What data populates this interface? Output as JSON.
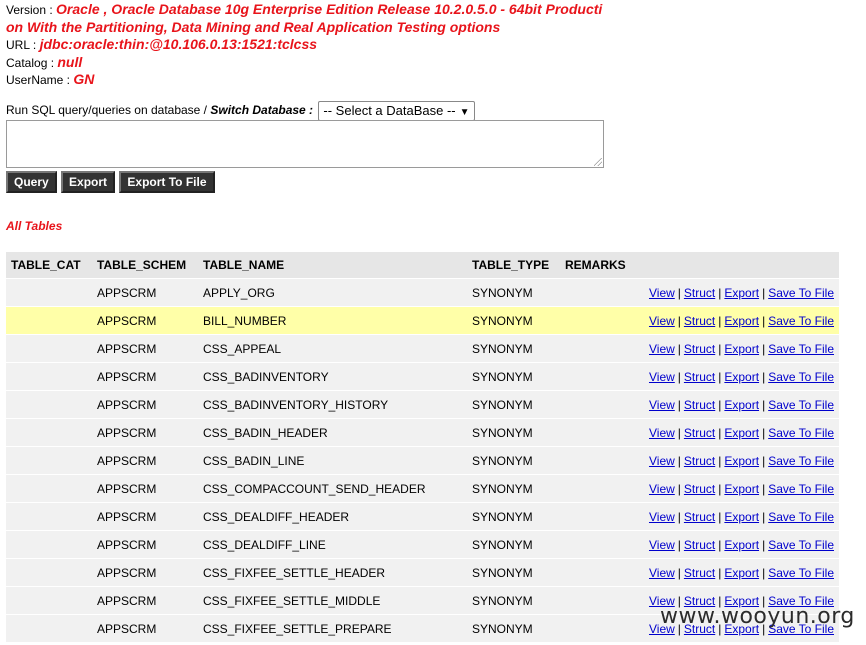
{
  "info": {
    "version_label": "Version :",
    "version_value": "Oracle , Oracle Database 10g Enterprise Edition Release 10.2.0.5.0 - 64bit Producti",
    "version_value_2": "on With the Partitioning, Data Mining and Real Application Testing options",
    "url_label": "URL :",
    "url_value": "jdbc:oracle:thin:@10.106.0.13:1521:tclcss",
    "catalog_label": "Catalog :",
    "catalog_value": "null",
    "username_label": "UserName :",
    "username_value": "GN"
  },
  "sql": {
    "prompt": "Run SQL query/queries on database / ",
    "switch_label": "Switch Database :",
    "select_value": "-- Select a DataBase --",
    "query_text": ""
  },
  "buttons": {
    "query": "Query",
    "export": "Export",
    "export_file": "Export To File"
  },
  "all_tables_label": "All Tables",
  "table": {
    "headers": [
      "TABLE_CAT",
      "TABLE_SCHEM",
      "TABLE_NAME",
      "TABLE_TYPE",
      "REMARKS",
      ""
    ],
    "actions": [
      "View",
      "Struct",
      "Export",
      "Save To File"
    ],
    "rows": [
      {
        "cat": "",
        "schem": "APPSCRM",
        "name": "APPLY_ORG",
        "type": "SYNONYM",
        "remarks": ""
      },
      {
        "cat": "",
        "schem": "APPSCRM",
        "name": "BILL_NUMBER",
        "type": "SYNONYM",
        "remarks": ""
      },
      {
        "cat": "",
        "schem": "APPSCRM",
        "name": "CSS_APPEAL",
        "type": "SYNONYM",
        "remarks": ""
      },
      {
        "cat": "",
        "schem": "APPSCRM",
        "name": "CSS_BADINVENTORY",
        "type": "SYNONYM",
        "remarks": ""
      },
      {
        "cat": "",
        "schem": "APPSCRM",
        "name": "CSS_BADINVENTORY_HISTORY",
        "type": "SYNONYM",
        "remarks": ""
      },
      {
        "cat": "",
        "schem": "APPSCRM",
        "name": "CSS_BADIN_HEADER",
        "type": "SYNONYM",
        "remarks": ""
      },
      {
        "cat": "",
        "schem": "APPSCRM",
        "name": "CSS_BADIN_LINE",
        "type": "SYNONYM",
        "remarks": ""
      },
      {
        "cat": "",
        "schem": "APPSCRM",
        "name": "CSS_COMPACCOUNT_SEND_HEADER",
        "type": "SYNONYM",
        "remarks": ""
      },
      {
        "cat": "",
        "schem": "APPSCRM",
        "name": "CSS_DEALDIFF_HEADER",
        "type": "SYNONYM",
        "remarks": ""
      },
      {
        "cat": "",
        "schem": "APPSCRM",
        "name": "CSS_DEALDIFF_LINE",
        "type": "SYNONYM",
        "remarks": ""
      },
      {
        "cat": "",
        "schem": "APPSCRM",
        "name": "CSS_FIXFEE_SETTLE_HEADER",
        "type": "SYNONYM",
        "remarks": ""
      },
      {
        "cat": "",
        "schem": "APPSCRM",
        "name": "CSS_FIXFEE_SETTLE_MIDDLE",
        "type": "SYNONYM",
        "remarks": ""
      },
      {
        "cat": "",
        "schem": "APPSCRM",
        "name": "CSS_FIXFEE_SETTLE_PREPARE",
        "type": "SYNONYM",
        "remarks": ""
      }
    ],
    "highlighted_row": 1
  },
  "watermark": "www.wooyun.org",
  "colors": {
    "accent_red": "#e8141b",
    "link": "#0000cc",
    "highlight": "#ffffa8"
  }
}
